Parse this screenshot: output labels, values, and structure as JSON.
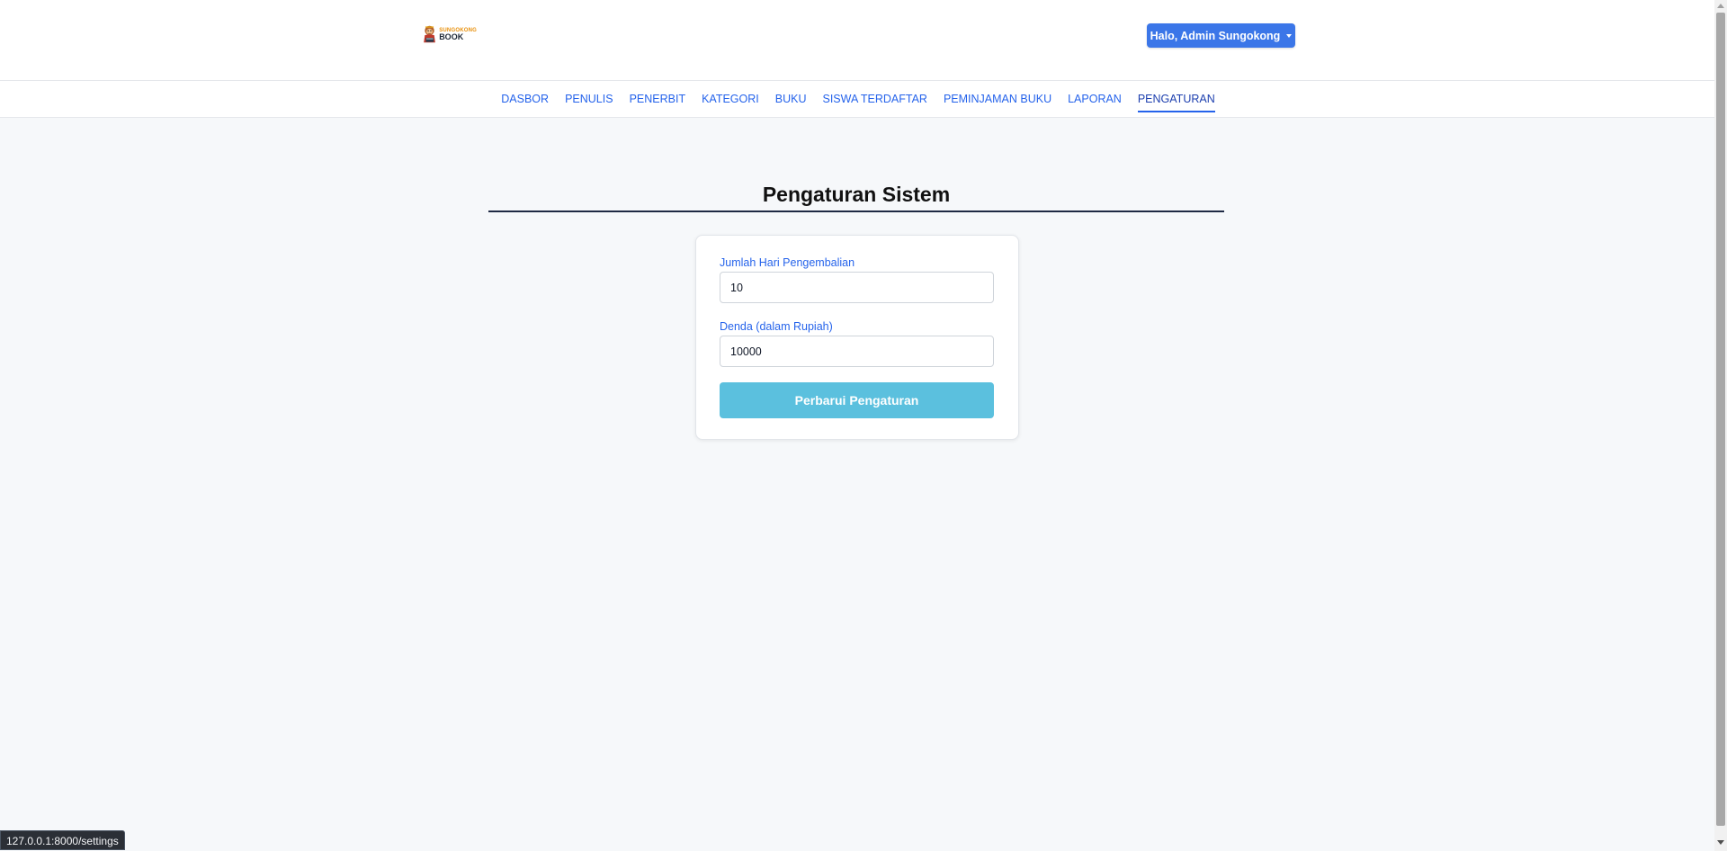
{
  "brand": {
    "logo_top_text": "SUNGOKONG",
    "logo_bottom_text": "BOOK"
  },
  "user_menu": {
    "label": "Halo, Admin Sungokong"
  },
  "nav": {
    "items": [
      {
        "label": "DASBOR",
        "active": false
      },
      {
        "label": "PENULIS",
        "active": false
      },
      {
        "label": "PENERBIT",
        "active": false
      },
      {
        "label": "KATEGORI",
        "active": false
      },
      {
        "label": "BUKU",
        "active": false
      },
      {
        "label": "SISWA TERDAFTAR",
        "active": false
      },
      {
        "label": "PEMINJAMAN BUKU",
        "active": false
      },
      {
        "label": "LAPORAN",
        "active": false
      },
      {
        "label": "PENGATURAN",
        "active": true
      }
    ]
  },
  "page": {
    "title": "Pengaturan Sistem"
  },
  "form": {
    "return_days_label": "Jumlah Hari Pengembalian",
    "return_days_value": "10",
    "fine_label": "Denda (dalam Rupiah)",
    "fine_value": "10000",
    "submit_label": "Perbarui Pengaturan"
  },
  "status_bar": {
    "url": "127.0.0.1:8000/settings"
  },
  "colors": {
    "primary": "#3b76e8",
    "link": "#2563eb",
    "submit": "#5bc0de",
    "background": "#f6f8fa"
  }
}
